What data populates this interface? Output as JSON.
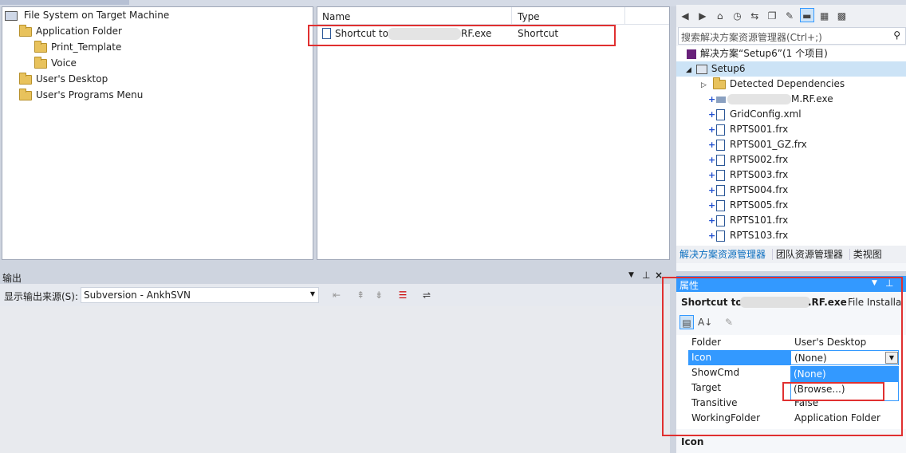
{
  "fs_tree": {
    "root": "File System on Target Machine",
    "items": [
      {
        "label": "Application Folder",
        "indent": 1
      },
      {
        "label": "Print_Template",
        "indent": 2
      },
      {
        "label": "Voice",
        "indent": 2
      },
      {
        "label": "User's Desktop",
        "indent": 1
      },
      {
        "label": "User's Programs Menu",
        "indent": 1
      }
    ]
  },
  "file_list": {
    "col_name": "Name",
    "col_type": "Type",
    "row": {
      "name_prefix": "Shortcut to",
      "name_suffix": "RF.exe",
      "type": "Shortcut"
    }
  },
  "solution_explorer": {
    "search_placeholder": "搜索解决方案资源管理器(Ctrl+;)",
    "solution_label": "解决方案“Setup6”(1 个项目)",
    "project": "Setup6",
    "dependencies": "Detected Dependencies",
    "files": [
      "M.RF.exe",
      "GridConfig.xml",
      "RPTS001.frx",
      "RPTS001_GZ.frx",
      "RPTS002.frx",
      "RPTS003.frx",
      "RPTS004.frx",
      "RPTS005.frx",
      "RPTS101.frx",
      "RPTS103.frx"
    ],
    "tabs": [
      "解决方案资源管理器",
      "团队资源管理器",
      "类视图"
    ]
  },
  "output": {
    "title": "输出",
    "source_label": "显示输出来源(S):",
    "source_value": "Subversion - AnkhSVN"
  },
  "properties": {
    "title": "属性",
    "object_prefix": "Shortcut to",
    "object_suffix": ".RF.exe",
    "object_type": "File Installa",
    "rows": [
      {
        "name": "Folder",
        "value": "User's Desktop"
      },
      {
        "name": "Icon",
        "value": "(None)"
      },
      {
        "name": "ShowCmd",
        "value": ""
      },
      {
        "name": "Target",
        "value": ""
      },
      {
        "name": "Transitive",
        "value": "False"
      },
      {
        "name": "WorkingFolder",
        "value": "Application Folder"
      }
    ],
    "dropdown_options": [
      "(None)",
      "(Browse...)"
    ],
    "desc_title": "Icon"
  },
  "colors": {
    "accent": "#3399ff",
    "highlight": "red"
  }
}
